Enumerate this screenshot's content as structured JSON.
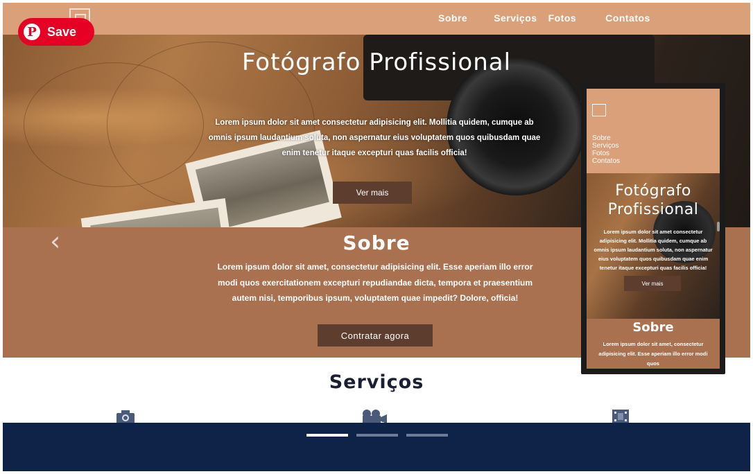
{
  "nav": {
    "links": [
      "Sobre",
      "Serviços",
      "Fotos",
      "Contatos"
    ]
  },
  "pinterest": {
    "save_label": "Save",
    "icon": "pinterest-icon",
    "color": "#e60023"
  },
  "hero": {
    "title": "Fotógrafo Profissional",
    "text": "Lorem ipsum dolor sit amet consectetur adipisicing elit. Mollitia quidem, cumque ab omnis ipsum laudantium soluta, non aspernatur eius voluptatem quos quibusdam quae enim tenetur itaque excepturi quas facilis officia!",
    "button": "Ver mais"
  },
  "sobre": {
    "title": "Sobre",
    "text": "Lorem ipsum dolor sit amet, consectetur adipisicing elit. Esse aperiam illo error modi quos exercitationem excepturi repudiandae dicta, tempora et praesentium autem nisi, temporibus ipsum, voluptatem quae impedit? Dolore, officia!",
    "button": "Contratar agora"
  },
  "servicos": {
    "title": "Serviços",
    "icons": [
      "camera-icon",
      "video-camera-icon",
      "film-icon"
    ]
  },
  "carousel": {
    "slides": 3,
    "active_index": 0
  },
  "mobile_preview": {
    "nav_links": [
      "Sobre",
      "Serviços",
      "Fotos",
      "Contatos"
    ],
    "hero_title": "Fotógrafo Profissional",
    "hero_text": "Lorem ipsum dolor sit amet consectetur adipisicing elit. Mollitia quidem, cumque ab omnis ipsum laudantium soluta, non aspernatur eius voluptatem quos quibusdam quae enim tenetur itaque excepturi quas facilis officia!",
    "hero_button": "Ver mais",
    "sobre_title": "Sobre",
    "sobre_text": "Lorem ipsum dolor sit amet, consectetur adipisicing elit. Esse aperiam illo error modi quos"
  },
  "colors": {
    "nav_bg": "#d9a07a",
    "sobre_bg": "#a9714f",
    "button_bg": "#5c3d2e",
    "footer_bg": "#0f2248",
    "heading": "#1b1f33"
  }
}
